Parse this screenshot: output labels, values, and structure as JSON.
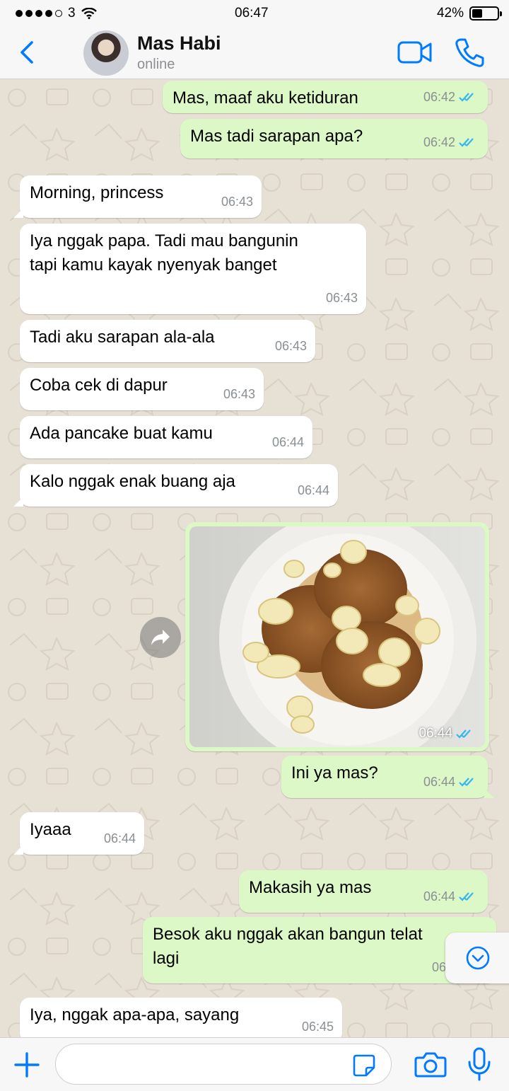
{
  "status_bar": {
    "carrier": "3",
    "time": "06:47",
    "battery": "42%",
    "battery_level": 0.42
  },
  "header": {
    "contact_name": "Mas Habi",
    "contact_status": "online",
    "accent_color": "#007aff"
  },
  "messages": [
    {
      "dir": "out",
      "text": "Mas, maaf aku ketiduran",
      "time": "06:42",
      "read": true
    },
    {
      "dir": "out",
      "text": "Mas tadi sarapan apa?",
      "time": "06:42",
      "read": true
    },
    {
      "dir": "in",
      "text": "Morning, princess",
      "time": "06:43"
    },
    {
      "dir": "in",
      "text": "Iya nggak papa. Tadi mau bangunin\ntapi kamu kayak nyenyak banget",
      "time": "06:43"
    },
    {
      "dir": "in",
      "text": "Tadi aku sarapan ala-ala",
      "time": "06:43"
    },
    {
      "dir": "in",
      "text": "Coba cek di dapur",
      "time": "06:43"
    },
    {
      "dir": "in",
      "text": "Ada pancake buat kamu",
      "time": "06:44"
    },
    {
      "dir": "in",
      "text": "Kalo nggak enak buang aja",
      "time": "06:44"
    },
    {
      "dir": "out",
      "text": "Ini ya mas?",
      "time": "06:44",
      "read": true
    },
    {
      "dir": "in",
      "text": "Iyaaa",
      "time": "06:44"
    },
    {
      "dir": "out",
      "text": "Makasih ya mas",
      "time": "06:44",
      "read": true
    },
    {
      "dir": "out",
      "text": "Besok aku nggak akan bangun telat\nlagi",
      "time": "06:45",
      "read": true
    },
    {
      "dir": "in",
      "text": "Iya, nggak apa-apa, sayang",
      "time": "06:45"
    }
  ],
  "image_message": {
    "time": "06:44",
    "read": true,
    "content": "pancake-with-banana-photo"
  },
  "colors": {
    "incoming_bubble": "#ffffff",
    "outgoing_bubble": "#dcf8c6",
    "read_ticks": "#34b7f1",
    "wallpaper": "#e6e0d5"
  },
  "input": {
    "value": "",
    "placeholder": ""
  },
  "icons": [
    "back-chevron",
    "video-call",
    "phone-call",
    "forward",
    "scroll-down",
    "plus",
    "sticker",
    "camera",
    "microphone"
  ]
}
